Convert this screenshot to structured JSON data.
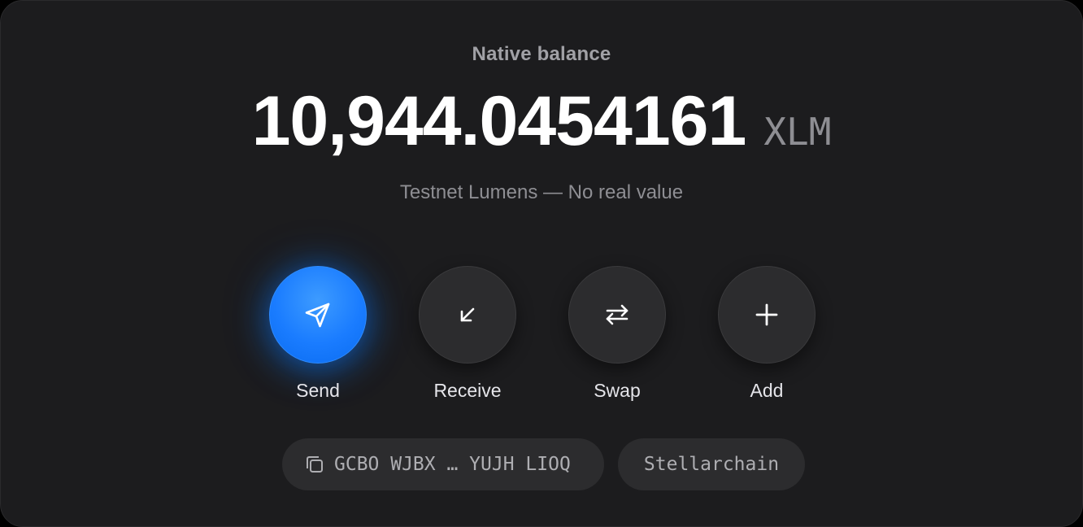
{
  "balance": {
    "label": "Native balance",
    "amount": "10,944.0454161",
    "unit": "XLM",
    "subtitle": "Testnet Lumens — No real value"
  },
  "actions": [
    {
      "label": "Send",
      "icon": "send-icon",
      "primary": true
    },
    {
      "label": "Receive",
      "icon": "arrow-down-left-icon",
      "primary": false
    },
    {
      "label": "Swap",
      "icon": "swap-icon",
      "primary": false
    },
    {
      "label": "Add",
      "icon": "plus-icon",
      "primary": false
    }
  ],
  "address_chip": {
    "text": "GCBO WJBX … YUJH LIOQ",
    "icon": "copy-icon"
  },
  "explorer_chip": {
    "text": "Stellarchain"
  },
  "colors": {
    "background": "#1c1c1e",
    "accent": "#1a7cff",
    "button": "#2c2c2e",
    "text_primary": "#ffffff",
    "text_secondary": "#8e8e93"
  }
}
